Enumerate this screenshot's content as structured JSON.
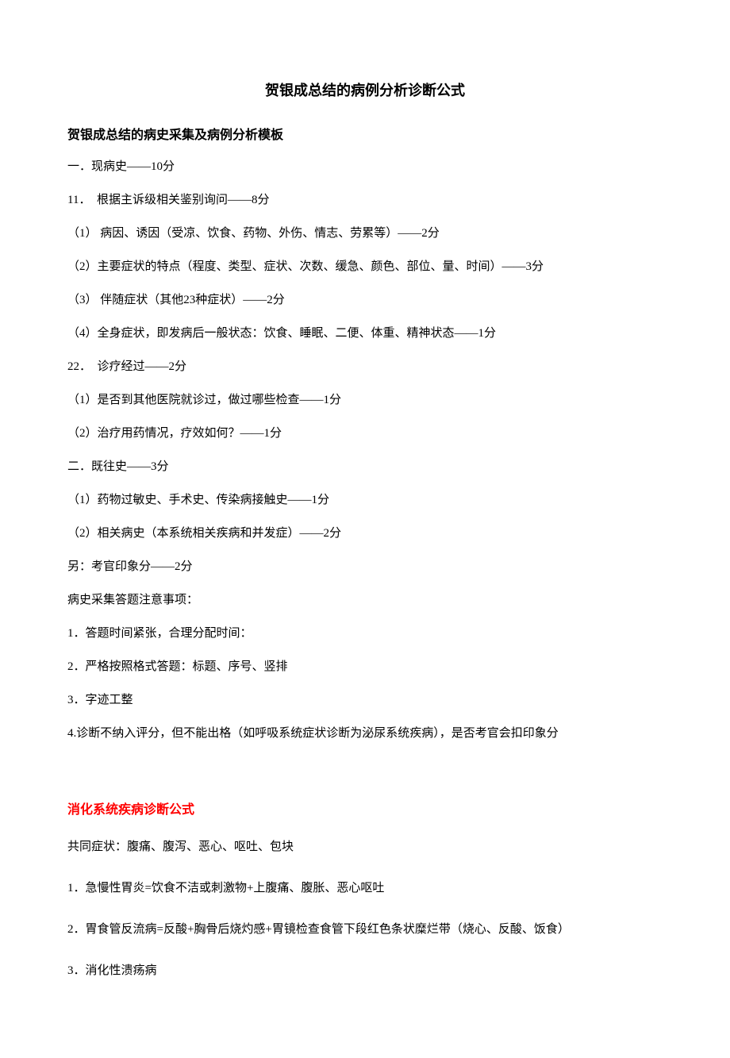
{
  "title": "贺银成总结的病例分析诊断公式",
  "subtitle": "贺银成总结的病史采集及病例分析模板",
  "lines": [
    "一．现病史——10分",
    "11．　根据主诉级相关鉴别询问——8分",
    "（1） 病因、诱因（受凉、饮食、药物、外伤、情志、劳累等）——2分",
    "（2）主要症状的特点（程度、类型、症状、次数、缓急、颜色、部位、量、时间）——3分",
    "（3） 伴随症状（其他23种症状）——2分",
    "（4）全身症状，即发病后一般状态：饮食、睡眠、二便、体重、精神状态——1分",
    "22．　诊疗经过——2分",
    "（1）是否到其他医院就诊过，做过哪些检查——1分",
    "（2）治疗用药情况，疗效如何？——1分",
    "二．既往史——3分",
    "（1）药物过敏史、手术史、传染病接触史——1分",
    "（2）相关病史（本系统相关疾病和并发症）——2分",
    "另：考官印象分——2分",
    "病史采集答题注意事项：",
    "1．答题时间紧张，合理分配时间：",
    "2．严格按照格式答题：标题、序号、竖排",
    "3．字迹工整",
    "4.诊断不纳入评分，但不能出格（如呼吸系统症状诊断为泌尿系统疾病），是否考官会扣印象分"
  ],
  "section_heading": "消化系统疾病诊断公式",
  "section_lines": [
    "共同症状：腹痛、腹泻、恶心、呕吐、包块",
    "1．急慢性胃炎=饮食不洁或刺激物+上腹痛、腹胀、恶心呕吐",
    "2．胃食管反流病=反酸+胸骨后烧灼感+胃镜检查食管下段红色条状糜烂带（烧心、反酸、饭食）",
    "3．消化性溃疡病"
  ]
}
